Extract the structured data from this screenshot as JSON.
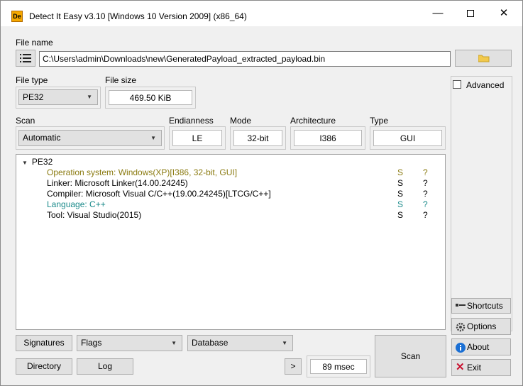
{
  "window": {
    "title": "Detect It Easy v3.10 [Windows 10 Version 2009] (x86_64)",
    "app_icon": "De",
    "controls": {
      "minimize": "—",
      "close": "✕"
    }
  },
  "file": {
    "label": "File name",
    "path": "C:\\Users\\admin\\Downloads\\new\\GeneratedPayload_extracted_payload.bin"
  },
  "file_type": {
    "label": "File type",
    "value": "PE32"
  },
  "file_size": {
    "label": "File size",
    "value": "469.50 KiB"
  },
  "scan": {
    "label": "Scan",
    "value": "Automatic"
  },
  "endianness": {
    "label": "Endianness",
    "value": "LE"
  },
  "mode": {
    "label": "Mode",
    "value": "32-bit"
  },
  "architecture": {
    "label": "Architecture",
    "value": "I386"
  },
  "type": {
    "label": "Type",
    "value": "GUI"
  },
  "advanced": {
    "label": "Advanced",
    "checked": false
  },
  "results": {
    "root": "PE32",
    "rows": [
      {
        "text": "Operation system: Windows(XP)[I386, 32-bit, GUI]",
        "s": "S",
        "q": "?",
        "color": "#8a7a10"
      },
      {
        "text": "Linker: Microsoft Linker(14.00.24245)",
        "s": "S",
        "q": "?",
        "color": "#000000"
      },
      {
        "text": "Compiler: Microsoft Visual C/C++(19.00.24245)[LTCG/C++]",
        "s": "S",
        "q": "?",
        "color": "#000000"
      },
      {
        "text": "Language: C++",
        "s": "S",
        "q": "?",
        "color": "#1a8a8a"
      },
      {
        "text": "Tool: Visual Studio(2015)",
        "s": "S",
        "q": "?",
        "color": "#000000"
      }
    ]
  },
  "bottom": {
    "signatures": "Signatures",
    "flags": "Flags",
    "database": "Database",
    "directory": "Directory",
    "log": "Log",
    "next": ">",
    "time": "89 msec",
    "scan_button": "Scan"
  },
  "side": {
    "shortcuts": "Shortcuts",
    "options": "Options",
    "about": "About",
    "exit": "Exit"
  },
  "colors": {
    "window_bg": "#f0f0f0",
    "accent_blue": "#1a6fd4",
    "exit_red": "#c8102e"
  }
}
